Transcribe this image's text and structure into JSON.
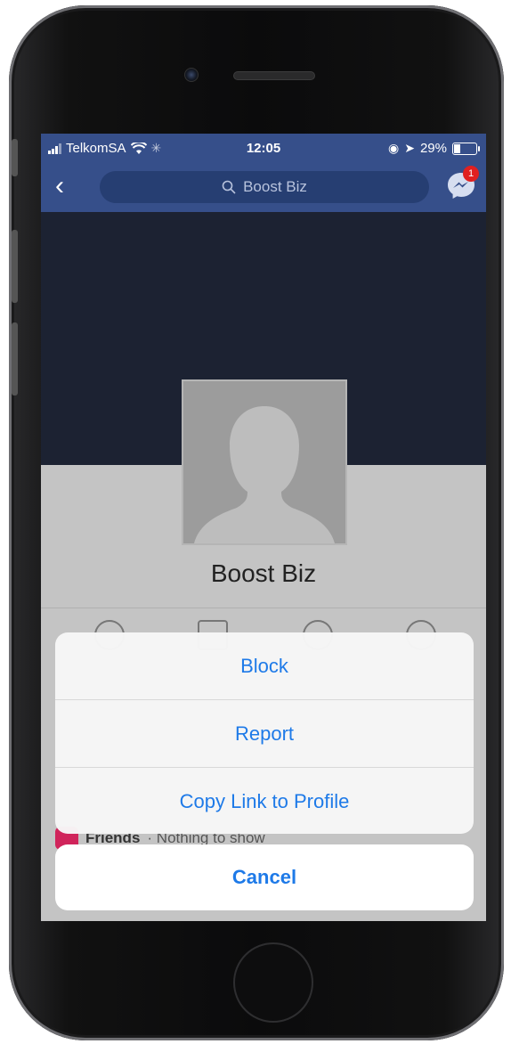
{
  "status_bar": {
    "carrier": "TelkomSA",
    "time": "12:05",
    "battery": "29%",
    "battery_level": 0.29
  },
  "nav": {
    "back_icon": "chevron-left-icon",
    "search_text": "Boost Biz",
    "messenger_badge": "1"
  },
  "profile": {
    "name": "Boost Biz"
  },
  "friends_row": {
    "label": "Friends",
    "text": "· Nothing to show"
  },
  "action_sheet": {
    "items": [
      "Block",
      "Report",
      "Copy Link to Profile"
    ],
    "cancel": "Cancel"
  },
  "colors": {
    "nav_bg": "#364f8a",
    "action_blue": "#1e7ae8",
    "cover_bg": "#1c2232"
  }
}
